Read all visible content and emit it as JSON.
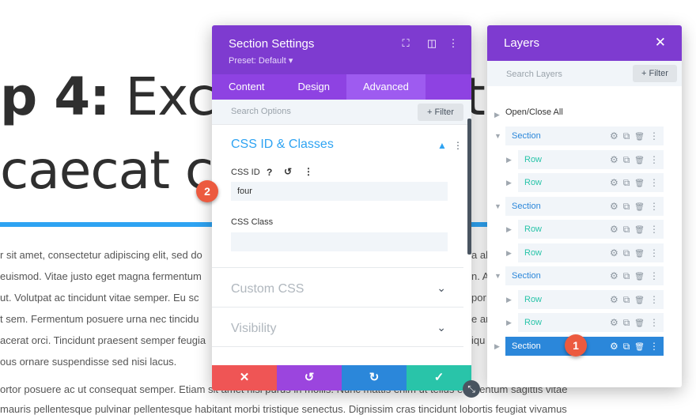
{
  "background": {
    "heading1_bold": "p 4:",
    "heading1_rest": " Exce",
    "heading1_tail": "t",
    "heading2": "caecat cu",
    "paragraph_lines": [
      "r sit amet, consectetur adipiscing elit, sed do",
      "euismod. Vitae justo eget magna fermentum",
      " ut. Volutpat ac tincidunt vitae semper. Eu sc",
      "t sem. Fermentum posuere urna nec tincidu",
      "acerat orci. Tincidunt praesent semper feugia",
      "ous ornare suspendisse sed nisi lacus."
    ],
    "right_fragments": [
      "a al",
      "n. A",
      "por",
      "e ar",
      "iqu"
    ],
    "footer_line1": "ortor posuere ac ut consequat semper. Etiam sit amet nisi purus in mollis. Nunc mattis enim ut tellus elementum sagittis vitae",
    "footer_line2": "mauris pellentesque pulvinar pellentesque habitant morbi tristique senectus. Dignissim cras tincidunt lobortis feugiat vivamus"
  },
  "settings": {
    "title": "Section Settings",
    "preset": "Preset: Default ▾",
    "tabs": [
      "Content",
      "Design",
      "Advanced"
    ],
    "active_tab": "Advanced",
    "search_placeholder": "Search Options",
    "filter_label": "+ Filter",
    "group_title": "CSS ID & Classes",
    "css_id_label": "CSS ID",
    "css_id_value": "four",
    "css_class_label": "CSS Class",
    "css_class_value": "",
    "collapsed_groups": [
      "Custom CSS",
      "Visibility"
    ],
    "icons": {
      "expand": "⛶",
      "columns": "◫",
      "more": "⋮",
      "help": "?",
      "reset": "↺",
      "collapse": "▲",
      "chevron": "⌄"
    },
    "footer_buttons": [
      {
        "name": "discard",
        "symbol": "✕",
        "color": "#ef5555"
      },
      {
        "name": "undo",
        "symbol": "↺",
        "color": "#9b45de"
      },
      {
        "name": "redo",
        "symbol": "↻",
        "color": "#2b87da"
      },
      {
        "name": "save",
        "symbol": "✓",
        "color": "#29c4a9"
      }
    ]
  },
  "layers": {
    "title": "Layers",
    "close": "✕",
    "search_placeholder": "Search Layers",
    "filter_label": "+ Filter",
    "open_close_all": "Open/Close All",
    "rows": [
      {
        "label": "Section",
        "type": "section",
        "color": "#2b87da"
      },
      {
        "label": "Row",
        "type": "row",
        "color": "#29c4a9"
      },
      {
        "label": "Row",
        "type": "row",
        "color": "#29c4a9"
      },
      {
        "label": "Section",
        "type": "section",
        "color": "#2b87da"
      },
      {
        "label": "Row",
        "type": "row",
        "color": "#29c4a9"
      },
      {
        "label": "Row",
        "type": "row",
        "color": "#29c4a9"
      },
      {
        "label": "Section",
        "type": "section",
        "color": "#2b87da"
      },
      {
        "label": "Row",
        "type": "row",
        "color": "#29c4a9"
      },
      {
        "label": "Row",
        "type": "row",
        "color": "#29c4a9"
      },
      {
        "label": "Section",
        "type": "section",
        "selected": true,
        "color": "#2b87da"
      }
    ],
    "row_icons": {
      "gear": "⚙",
      "duplicate": "⧉",
      "trash": "🗑",
      "more": "⋮"
    }
  },
  "badges": {
    "one": "1",
    "two": "2"
  },
  "colors": {
    "purple": "#7e3bd0",
    "tab_purple": "#8e42e2",
    "accent_blue": "#2ea3f2",
    "badge_orange": "#ec5a3f"
  }
}
